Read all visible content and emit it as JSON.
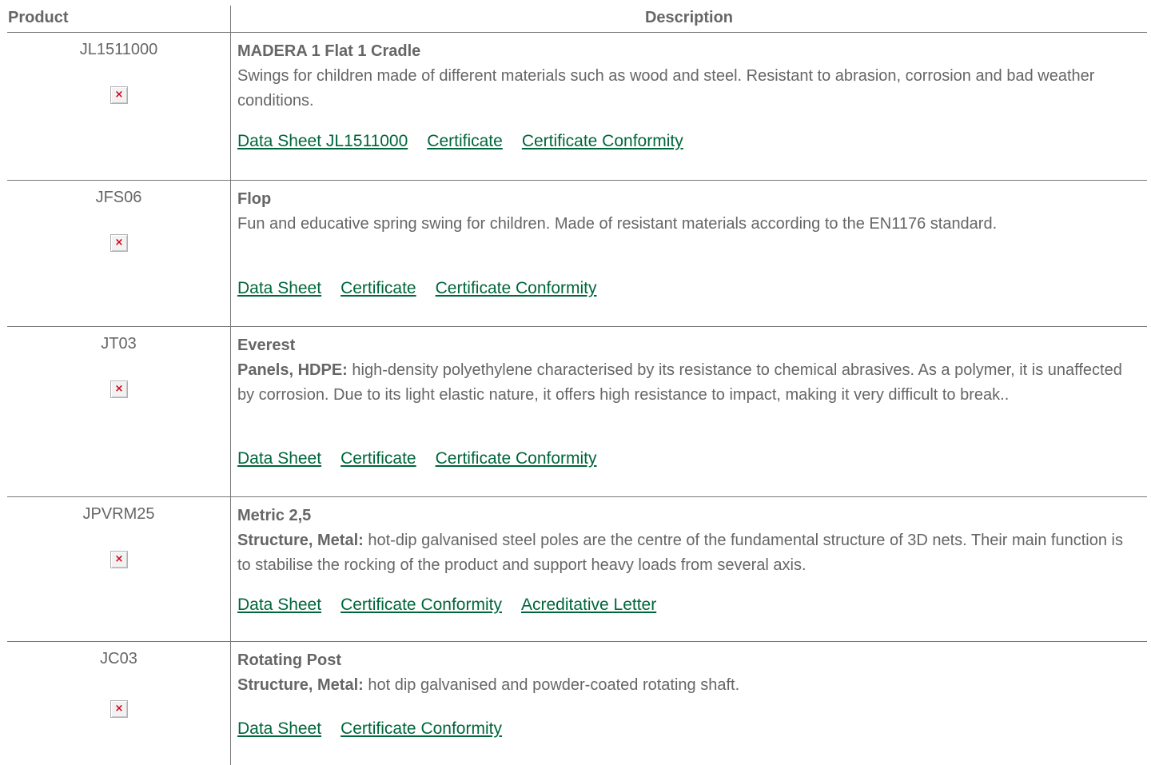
{
  "header": {
    "product": "Product",
    "description": "Description"
  },
  "rows": [
    {
      "code": "JL1511000",
      "image_icon": "broken-image-icon",
      "title": "MADERA 1 Flat 1 Cradle",
      "label": "",
      "text": "Swings for children made of different materials such as wood and steel. Resistant to abrasion, corrosion and bad weather conditions.",
      "links": [
        "Data Sheet JL1511000",
        "Certificate",
        "Certificate Conformity"
      ]
    },
    {
      "code": "JFS06",
      "image_icon": "broken-image-icon",
      "title": "Flop",
      "label": "",
      "text": "Fun and educative spring swing for children. Made of resistant materials according to the EN1176 standard.",
      "links": [
        "Data Sheet",
        "Certificate",
        "Certificate Conformity"
      ]
    },
    {
      "code": "JT03",
      "image_icon": "broken-image-icon",
      "title": "Everest",
      "label": "Panels, HDPE:",
      "text": " high-density polyethylene characterised by its resistance to chemical abrasives. As a polymer, it is unaffected by corrosion. Due to its light elastic nature, it offers high resistance to impact, making it very difficult to break..",
      "links": [
        "Data Sheet",
        "Certificate",
        "Certificate Conformity"
      ]
    },
    {
      "code": "JPVRM25",
      "image_icon": "broken-image-icon",
      "title": "Metric 2,5",
      "label": "Structure, Metal:",
      "text": " hot-dip galvanised steel poles are the centre of the fundamental structure of 3D nets. Their main function is to stabilise the rocking of the product and support heavy loads from several axis.",
      "links": [
        "Data Sheet",
        "Certificate Conformity",
        "Acreditative Letter"
      ]
    },
    {
      "code": "JC03",
      "image_icon": "broken-image-icon",
      "title": "Rotating Post",
      "label": "Structure, Metal:",
      "text": " hot dip galvanised and powder-coated rotating shaft.",
      "links": [
        "Data Sheet",
        "Certificate Conformity"
      ]
    }
  ],
  "colors": {
    "text": "#666666",
    "link": "#00663c",
    "rule": "#777777"
  }
}
